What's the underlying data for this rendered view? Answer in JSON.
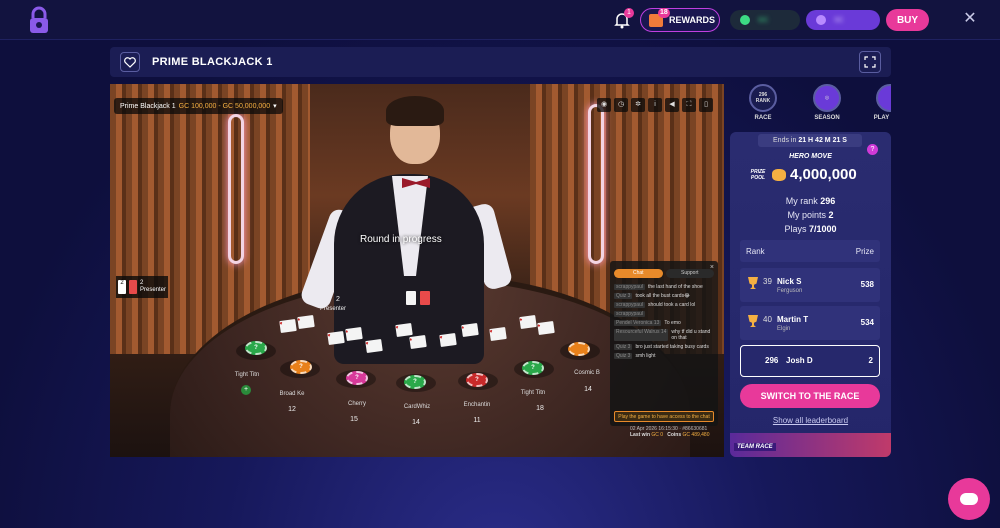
{
  "topbar": {
    "notification_count": "1",
    "rewards_count": "18",
    "rewards_label": "REWARDS",
    "gc_balance": "GC",
    "sc_balance": "SC",
    "buy_label": "BUY"
  },
  "game": {
    "title": "PRIME BLACKJACK 1"
  },
  "video": {
    "table_name": "Prime Blackjack 1",
    "limits": "GC 100,000 - GC 50,000,000",
    "round_status": "Round in progress",
    "presenter_score": "2",
    "presenter_label": "Presenter",
    "dealer_marker": "2",
    "seats": [
      {
        "name": "Tight Titn",
        "number": ""
      },
      {
        "name": "Broad Ke",
        "number": "12"
      },
      {
        "name": "Cherry",
        "number": "15"
      },
      {
        "name": "CardWhiz",
        "number": "14"
      },
      {
        "name": "Enchantin",
        "number": "11"
      },
      {
        "name": "Tight Titn",
        "number": "18"
      },
      {
        "name": "Cosmic B",
        "number": "14"
      }
    ],
    "chips": [
      "?",
      "?",
      "?",
      "?",
      "?",
      "?"
    ],
    "footer": {
      "timestamp": "02 Apr 2026 16:15:30 · #86630681",
      "last_win_label": "Last win",
      "last_win_value": "GC 0",
      "coins_label": "Coins",
      "coins_value": "GC 489,480"
    }
  },
  "chat": {
    "close": "×",
    "tabs": [
      "Chat",
      "Support"
    ],
    "messages": [
      {
        "user": "scrappypaul",
        "text": "the last hand of the shoe"
      },
      {
        "user": "Quiz 3",
        "text": "took all the bust cards😂"
      },
      {
        "user": "scrappypaul",
        "text": "should took a card lol"
      },
      {
        "user": "scrappypaul",
        "text": ""
      },
      {
        "user": "Pendel Veronica 13",
        "text": "To emo"
      },
      {
        "user": "Resourceful Walrus 14",
        "text": "why tf did u stand on that"
      },
      {
        "user": "Quiz 3",
        "text": "bro just started taking busy cards"
      },
      {
        "user": "Quiz 3",
        "text": "smh light"
      }
    ],
    "footer": "Play the game to have access to the chat"
  },
  "race": {
    "tabs": [
      {
        "label": "RACE",
        "sub": "296",
        "sub2": "RANK"
      },
      {
        "label": "SEASON"
      },
      {
        "label": "PLAY"
      }
    ],
    "ends_label": "Ends in",
    "ends_value": "21 H 42 M 21 S",
    "help": "?",
    "hero_move": "HERO MOVE",
    "prize_pool_label": "PRIZE POOL",
    "prize_pool_value": "4,000,000",
    "my_rank_label": "My rank",
    "my_rank": "296",
    "my_points_label": "My points",
    "my_points": "2",
    "plays_label": "Plays",
    "plays": "7/1000",
    "lb_rank_header": "Rank",
    "lb_prize_header": "Prize",
    "leaderboard": [
      {
        "rank": "39",
        "name": "Nick S",
        "sub": "Ferguson",
        "prize": "538"
      },
      {
        "rank": "40",
        "name": "Martin T",
        "sub": "Elgin",
        "prize": "534"
      }
    ],
    "me": {
      "rank": "296",
      "name": "Josh D",
      "prize": "2"
    },
    "switch_label": "SWITCH TO THE RACE",
    "show_all": "Show all leaderboard",
    "team_race": "TEAM RACE"
  },
  "colors": {
    "accent": "#e8399a",
    "background": "#12133f",
    "gold": "#f5b042"
  }
}
